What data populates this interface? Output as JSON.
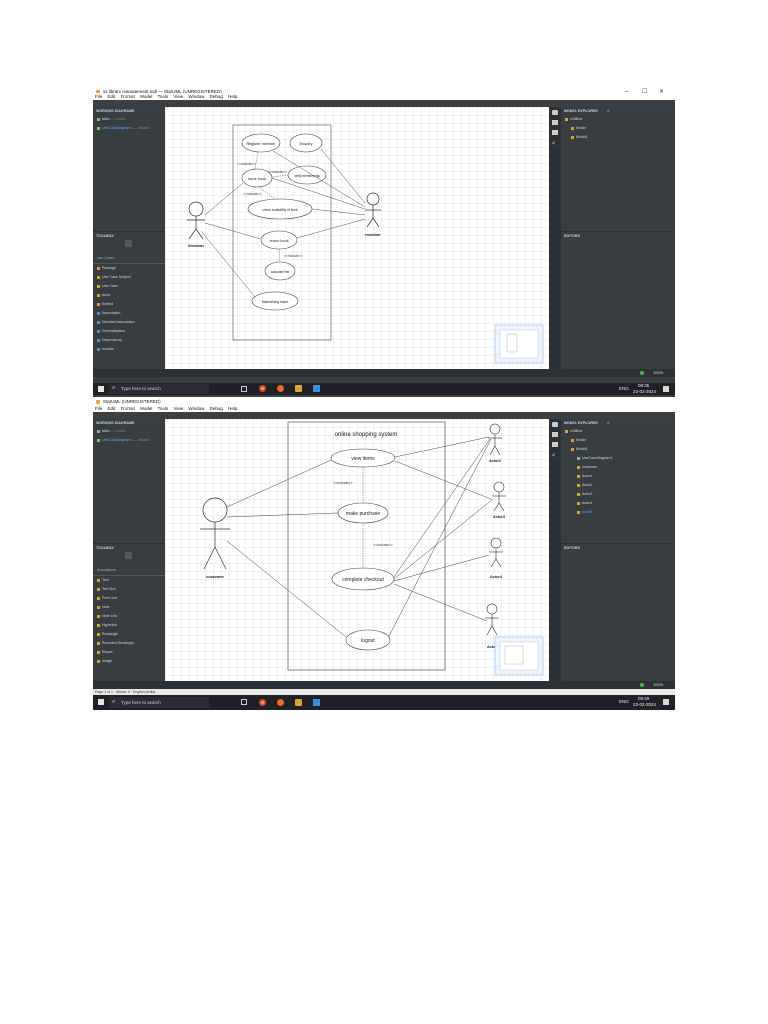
{
  "shot1": {
    "window_title": "ss library management.mdj — StarUML (UNREGISTERED)",
    "menu": [
      "File",
      "Edit",
      "Format",
      "Model",
      "Tools",
      "View",
      "Window",
      "Debug",
      "Help"
    ],
    "working_diagrams": {
      "title": "WORKING DIAGRAMS",
      "items": [
        {
          "label": "Main",
          "note": "— model"
        },
        {
          "label": "UseCaseDiagram1",
          "note": "— Model1"
        }
      ]
    },
    "toolbox": {
      "title": "TOOLBOX",
      "section": "Use Cases",
      "items": [
        "Package",
        "Use Case Subject",
        "Use Case",
        "Actor",
        "Extend",
        "Association",
        "Directed Association",
        "Generalization",
        "Dependency",
        "Include"
      ]
    },
    "model_explorer": {
      "title": "MODEL EXPLORER",
      "tree": [
        "Untitled",
        "Model",
        "Model1"
      ]
    },
    "editors_title": "EDITORS",
    "zoom": "100%",
    "diagram": {
      "usecases": [
        "Register member",
        "Enquiry",
        "issue book",
        "verify membership",
        "check availability of book",
        "return book",
        "calculate fine",
        "Maintaining Issue"
      ],
      "actors": [
        "librarian",
        "member"
      ],
      "stereotypes": [
        "<<include>>",
        "<<include>>",
        "<<include>>",
        "<<include>>"
      ]
    },
    "taskbar": {
      "search_placeholder": "Type here to search",
      "lang": "ENG",
      "time": "09:35",
      "date": "23-02-2024"
    }
  },
  "shot2": {
    "window_title": "StarUML (UNREGISTERED)",
    "menu": [
      "File",
      "Edit",
      "Format",
      "Model",
      "Tools",
      "View",
      "Window",
      "Debug",
      "Help"
    ],
    "working_diagrams": {
      "title": "WORKING DIAGRAMS",
      "items": [
        {
          "label": "Main",
          "note": "— model"
        },
        {
          "label": "UseCaseDiagram1",
          "note": "— Model1"
        }
      ]
    },
    "toolbox": {
      "title": "TOOLBOX",
      "section": "Annotations",
      "items": [
        "Text",
        "Text Box",
        "Free Line",
        "Note",
        "Note Link",
        "Hyperlink",
        "Rectangle",
        "Rounded Rectangle",
        "Ellipse",
        "Image"
      ]
    },
    "model_explorer": {
      "title": "MODEL EXPLORER",
      "tree": [
        "Untitled",
        "Model",
        "Model1",
        "UseCaseDiagram1",
        "customer",
        "Actor1",
        "Actor2",
        "Actor3",
        "Actor4",
        "Actor5"
      ]
    },
    "editors_title": "EDITORS",
    "zoom": "100%",
    "diagram": {
      "system_title": "online shopping system",
      "usecases": [
        "view items",
        "make purchase",
        "complete checkout",
        "logout"
      ],
      "actors": [
        "customer",
        "Actor2",
        "Actor3",
        "Actor4",
        "Actor"
      ],
      "stereotypes": [
        "<<include>>",
        "<<include>>"
      ]
    },
    "statusbar": "Page 1 of 1 · Words: 0 · English (India)",
    "taskbar": {
      "search_placeholder": "Type here to search",
      "lang": "ENG",
      "time": "09:49",
      "date": "23-02-2024"
    }
  },
  "colors": {
    "accent": "#59a8ff",
    "panel": "#3a3d40",
    "taskbar": "#1f2124",
    "folder": "#d9a23a"
  }
}
